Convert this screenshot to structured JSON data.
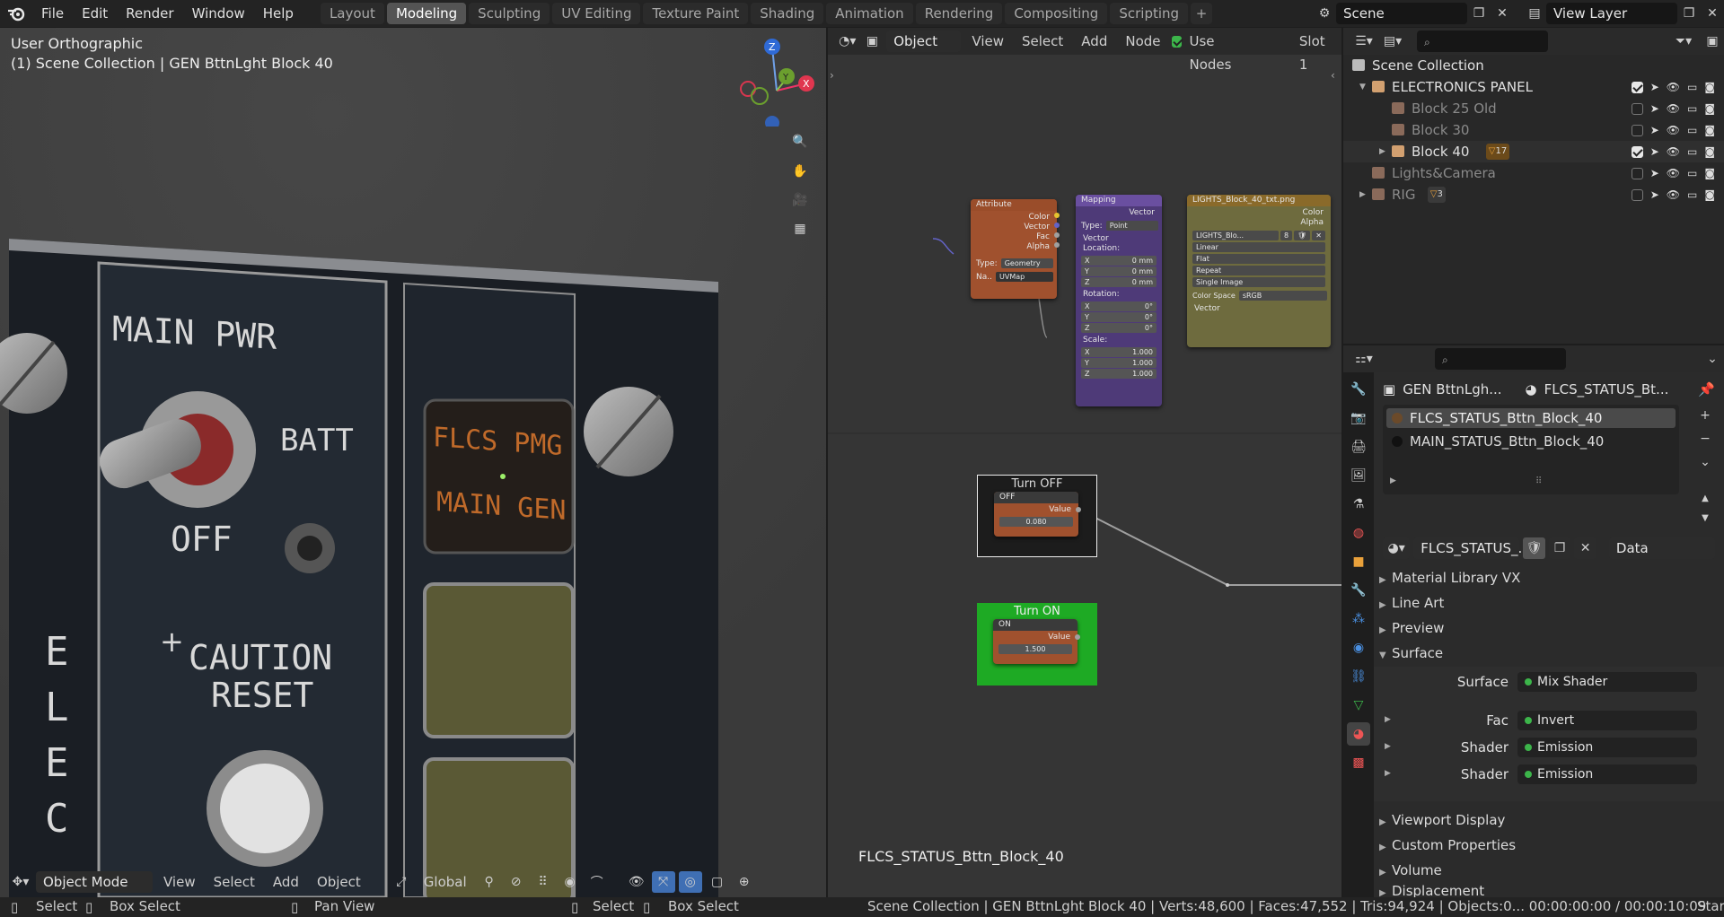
{
  "menu": {
    "items": [
      "File",
      "Edit",
      "Render",
      "Window",
      "Help"
    ]
  },
  "workspaces": [
    "Layout",
    "Modeling",
    "Sculpting",
    "UV Editing",
    "Texture Paint",
    "Shading",
    "Animation",
    "Rendering",
    "Compositing",
    "Scripting"
  ],
  "active_workspace": "Modeling",
  "scene": {
    "label": "Scene",
    "view_layer": "View Layer"
  },
  "viewport": {
    "view_name": "User Orthographic",
    "collection_info": "(1) Scene Collection | GEN BttnLght Block 40",
    "mode": "Object Mode",
    "menus": [
      "View",
      "Select",
      "Add",
      "Object"
    ],
    "transform": "Global",
    "panel_labels": {
      "main_pwr": "MAIN PWR",
      "batt": "BATT",
      "off": "OFF",
      "caution": "CAUTION",
      "reset": "RESET",
      "elec": "ELEC",
      "flcs": "FLCS PMG",
      "main_gen": "MAIN GEN",
      "plus": "+"
    }
  },
  "node_editor": {
    "type": "Object",
    "menus": [
      "View",
      "Select",
      "Add",
      "Node"
    ],
    "use_nodes_label": "Use Nodes",
    "slot": "Slot 1",
    "material_label": "FLCS_STATUS_Bttn_Block_40",
    "attribute": {
      "title": "Attribute",
      "outputs": [
        "Color",
        "Vector",
        "Fac",
        "Alpha"
      ],
      "type_label": "Type:",
      "type_value": "Geometry",
      "name_label": "Na..",
      "name_value": "UVMap"
    },
    "mapping": {
      "title": "Mapping",
      "output": "Vector",
      "type_label": "Type:",
      "type_value": "Point",
      "input": "Vector",
      "location_label": "Location:",
      "location": [
        [
          "X",
          "0 mm"
        ],
        [
          "Y",
          "0 mm"
        ],
        [
          "Z",
          "0 mm"
        ]
      ],
      "rotation_label": "Rotation:",
      "rotation": [
        [
          "X",
          "0°"
        ],
        [
          "Y",
          "0°"
        ],
        [
          "Z",
          "0°"
        ]
      ],
      "scale_label": "Scale:",
      "scale": [
        [
          "X",
          "1.000"
        ],
        [
          "Y",
          "1.000"
        ],
        [
          "Z",
          "1.000"
        ]
      ]
    },
    "image": {
      "title": "LIGHTS_Block_40_txt.png",
      "outputs": [
        "Color",
        "Alpha"
      ],
      "image_name": "LIGHTS_Blo...",
      "users": "8",
      "interp": "Linear",
      "proj": "Flat",
      "ext": "Repeat",
      "source": "Single Image",
      "color_space_label": "Color Space",
      "color_space": "sRGB",
      "input": "Vector"
    },
    "turn_off": {
      "frame": "Turn OFF",
      "node": "OFF",
      "output": "Value",
      "value": "0.080"
    },
    "turn_on": {
      "frame": "Turn ON",
      "node": "ON",
      "output": "Value",
      "value": "1.500"
    }
  },
  "outliner": {
    "rows": [
      {
        "label": "Scene Collection",
        "indent": 0
      },
      {
        "label": "ELECTRONICS PANEL",
        "indent": 1,
        "checked": true
      },
      {
        "label": "Block 25 Old",
        "indent": 2,
        "checked": false,
        "dim": true
      },
      {
        "label": "Block 30",
        "indent": 2,
        "checked": false,
        "dim": true
      },
      {
        "label": "Block 40",
        "indent": 2,
        "checked": true,
        "badge": "17"
      },
      {
        "label": "Lights&Camera",
        "indent": 1,
        "checked": false,
        "dim": true
      },
      {
        "label": "RIG",
        "indent": 1,
        "checked": false,
        "dim": true,
        "badge": "3"
      }
    ]
  },
  "properties": {
    "object_name": "GEN BttnLgh...",
    "material_name": "FLCS_STATUS_Bt...",
    "slots": [
      "FLCS_STATUS_Bttn_Block_40",
      "MAIN_STATUS_Bttn_Block_40"
    ],
    "browse_name": "FLCS_STATUS_...",
    "link": "Data",
    "panels": [
      "Material Library VX",
      "Line Art",
      "Preview",
      "Surface"
    ],
    "surface": {
      "surface_label": "Surface",
      "surface_value": "Mix Shader",
      "fac_label": "Fac",
      "fac_value": "Invert",
      "shader1_label": "Shader",
      "shader1_value": "Emission",
      "shader2_label": "Shader",
      "shader2_value": "Emission"
    },
    "panels_after": [
      "Viewport Display",
      "Custom Properties",
      "Volume",
      "Displacement"
    ]
  },
  "status": {
    "left": [
      {
        "key": "Select"
      },
      {
        "key": "Box Select"
      },
      {
        "key": "Pan View"
      },
      {
        "key": "Select"
      },
      {
        "key": "Box Select"
      }
    ],
    "info": "Scene Collection | GEN BttnLght Block 40 | Verts:48,600 | Faces:47,552 | Tris:94,924 | Objects:0... 00:00:00:00 / 00:00:10:09",
    "right": "Star"
  }
}
